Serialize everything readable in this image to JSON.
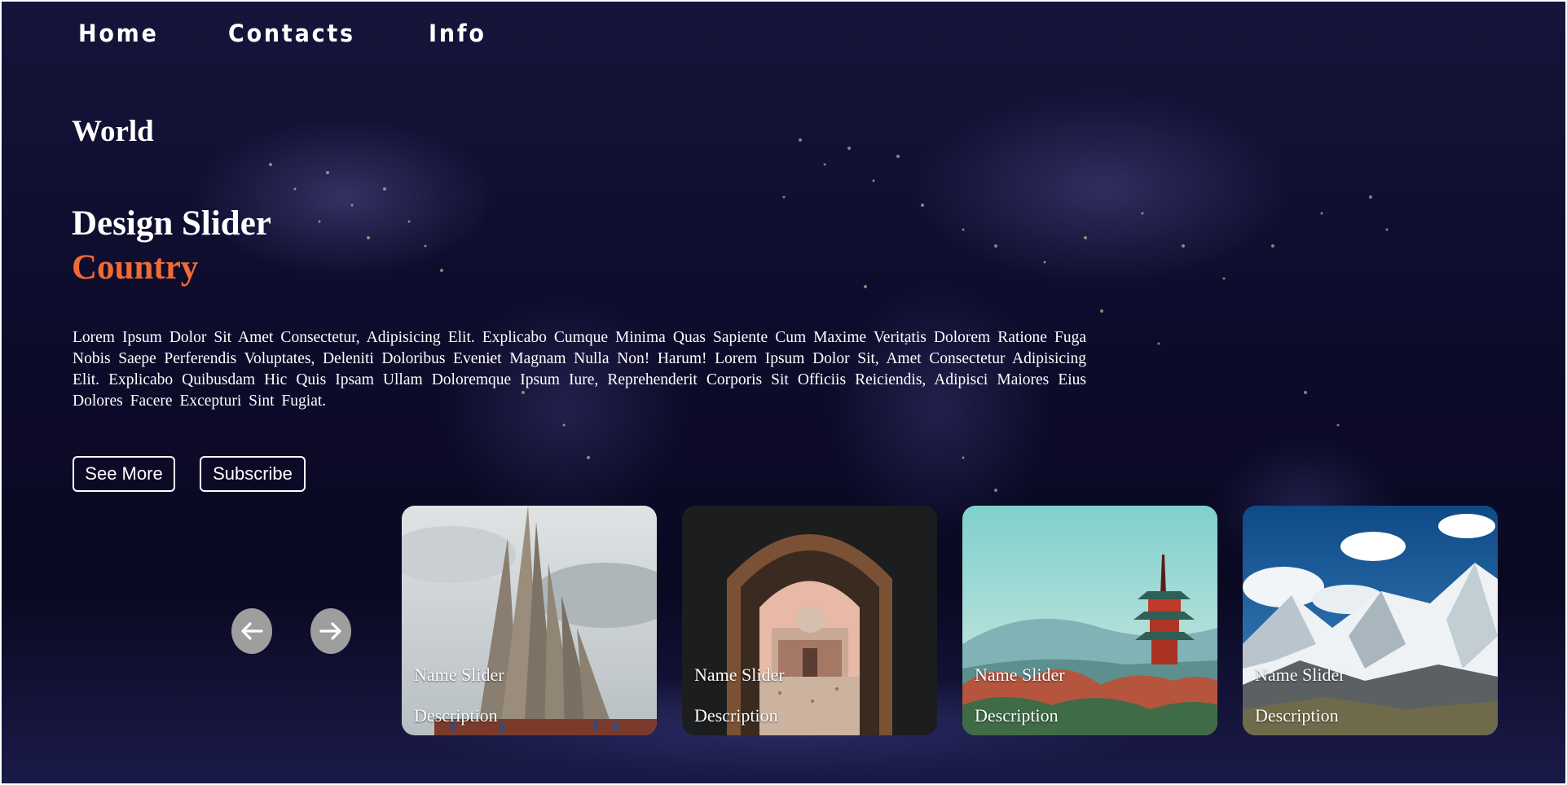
{
  "nav": {
    "items": [
      "Home",
      "Contacts",
      "Info"
    ]
  },
  "hero": {
    "kicker": "World",
    "title_line1": "Design Slider",
    "title_line2": "Country",
    "accent_color": "#f06a34",
    "paragraph": "Lorem Ipsum Dolor Sit Amet Consectetur, Adipisicing Elit. Explicabo Cumque Minima Quas Sapiente Cum Maxime Veritatis Dolorem Ratione Fuga Nobis Saepe Perferendis Voluptates, Deleniti Doloribus Eveniet Magnam Nulla Non! Harum! Lorem Ipsum Dolor Sit, Amet Consectetur Adipisicing Elit. Explicabo Quibusdam Hic Quis Ipsam Ullam Doloremque Ipsum Iure, Reprehenderit Corporis Sit Officiis Reiciendis, Adipisci Maiores Eius Dolores Facere Excepturi Sint Fugiat."
  },
  "buttons": {
    "see_more": "See More",
    "subscribe": "Subscribe"
  },
  "slider": {
    "prev_icon": "arrow-left-icon",
    "next_icon": "arrow-right-icon",
    "cards": [
      {
        "name": "Name Slider",
        "description": "Description",
        "image": "concrete-monument-photo"
      },
      {
        "name": "Name Slider",
        "description": "Description",
        "image": "archway-mausoleum-photo"
      },
      {
        "name": "Name Slider",
        "description": "Description",
        "image": "pagoda-landscape-photo"
      },
      {
        "name": "Name Slider",
        "description": "Description",
        "image": "snowy-mountains-photo"
      }
    ]
  }
}
